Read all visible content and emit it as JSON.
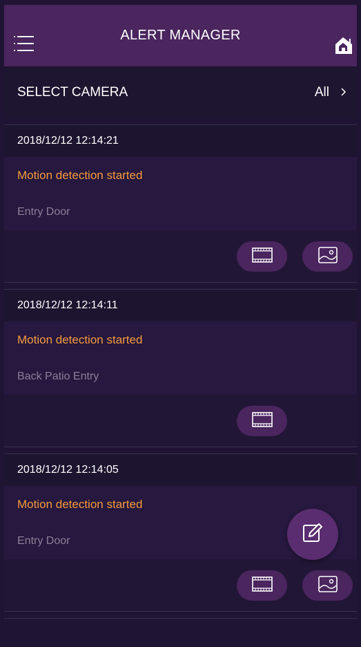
{
  "header": {
    "title": "ALERT MANAGER",
    "menu_icon": "hamburger-menu-icon",
    "home_icon": "home-icon",
    "accent_color": "#4a255e"
  },
  "camera_selector": {
    "label": "SELECT CAMERA",
    "value": "All"
  },
  "alerts": [
    {
      "datetime": "2018/12/12 12:14:21",
      "event": "Motion detection started",
      "camera": "Entry Door",
      "actions": [
        "video",
        "snapshot"
      ]
    },
    {
      "datetime": "2018/12/12 12:14:11",
      "event": "Motion detection started",
      "camera": "Back Patio Entry",
      "actions": [
        "video"
      ]
    },
    {
      "datetime": "2018/12/12 12:14:05",
      "event": "Motion detection started",
      "camera": "Entry Door",
      "actions": [
        "video",
        "snapshot"
      ]
    }
  ],
  "fab": {
    "icon": "edit-icon"
  },
  "colors": {
    "event_text": "#f59a3d",
    "camera_text": "#8b8199",
    "background": "#1f1433"
  }
}
